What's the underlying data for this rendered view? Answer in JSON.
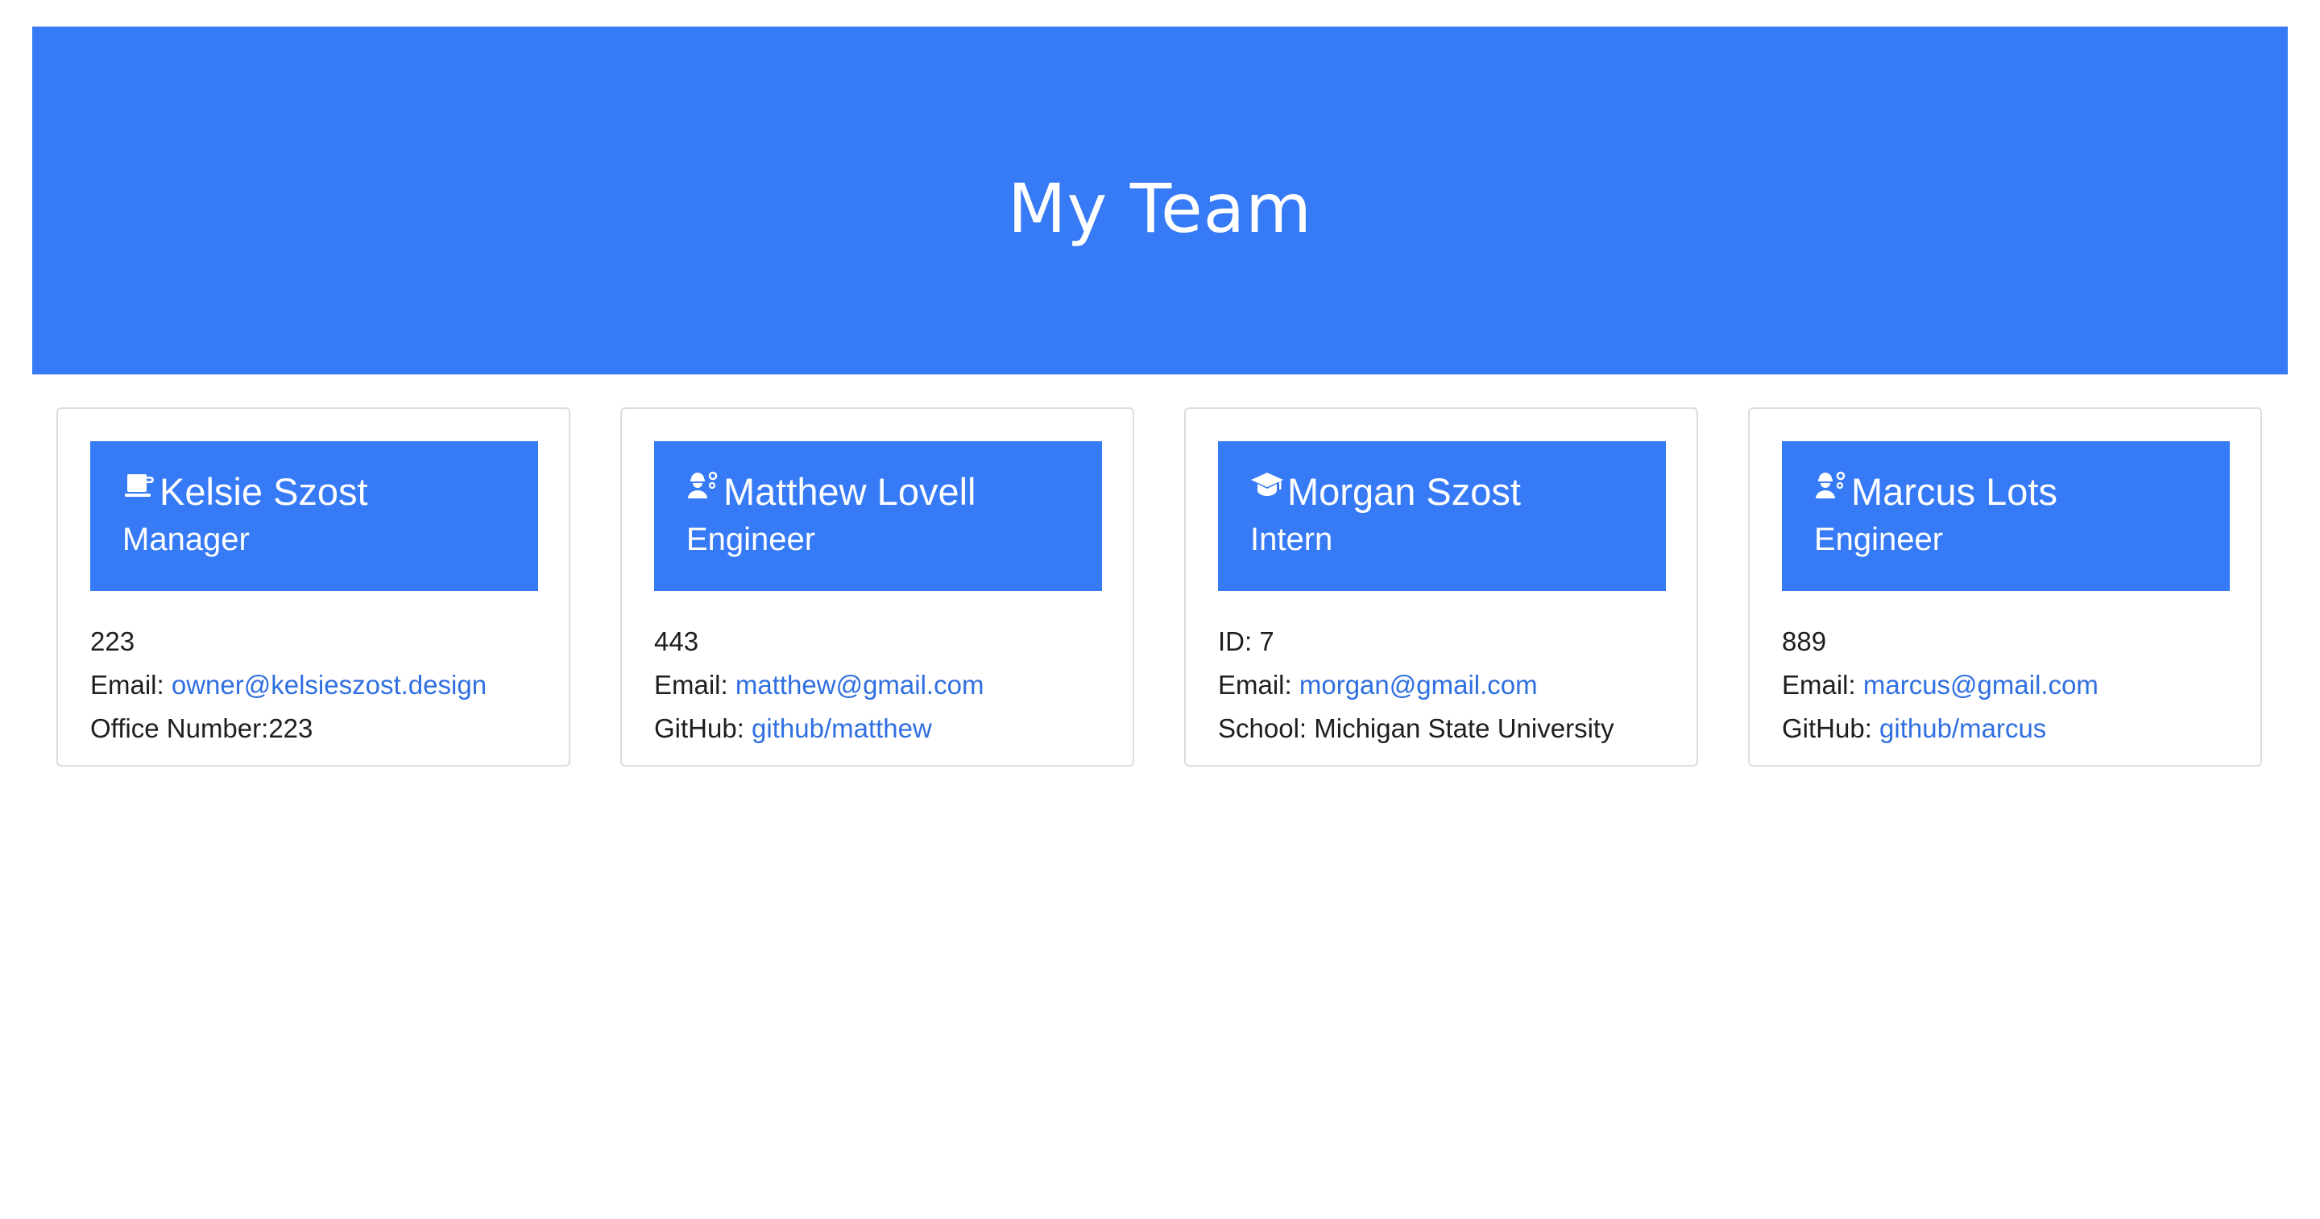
{
  "header": {
    "title": "My Team"
  },
  "colors": {
    "accent": "#377af6",
    "link": "#2f6fe0"
  },
  "cards": [
    {
      "icon": "mug-icon",
      "name": "Kelsie Szost",
      "role": "Manager",
      "id_line": "223",
      "email_label": "Email:",
      "email": "owner@kelsieszost.design",
      "third_label": "Office Number:",
      "third_value": "223"
    },
    {
      "icon": "engineer-icon",
      "name": "Matthew Lovell",
      "role": "Engineer",
      "id_line": "443",
      "email_label": "Email:",
      "email": "matthew@gmail.com",
      "third_label": "GitHub:",
      "third_value": "github/matthew"
    },
    {
      "icon": "graduation-cap-icon",
      "name": "Morgan Szost",
      "role": "Intern",
      "id_line": "ID: 7",
      "email_label": "Email:",
      "email": "morgan@gmail.com",
      "third_label": "School:",
      "third_value": "Michigan State University"
    },
    {
      "icon": "engineer-icon",
      "name": "Marcus Lots",
      "role": "Engineer",
      "id_line": "889",
      "email_label": "Email:",
      "email": "marcus@gmail.com",
      "third_label": "GitHub:",
      "third_value": "github/marcus"
    }
  ]
}
